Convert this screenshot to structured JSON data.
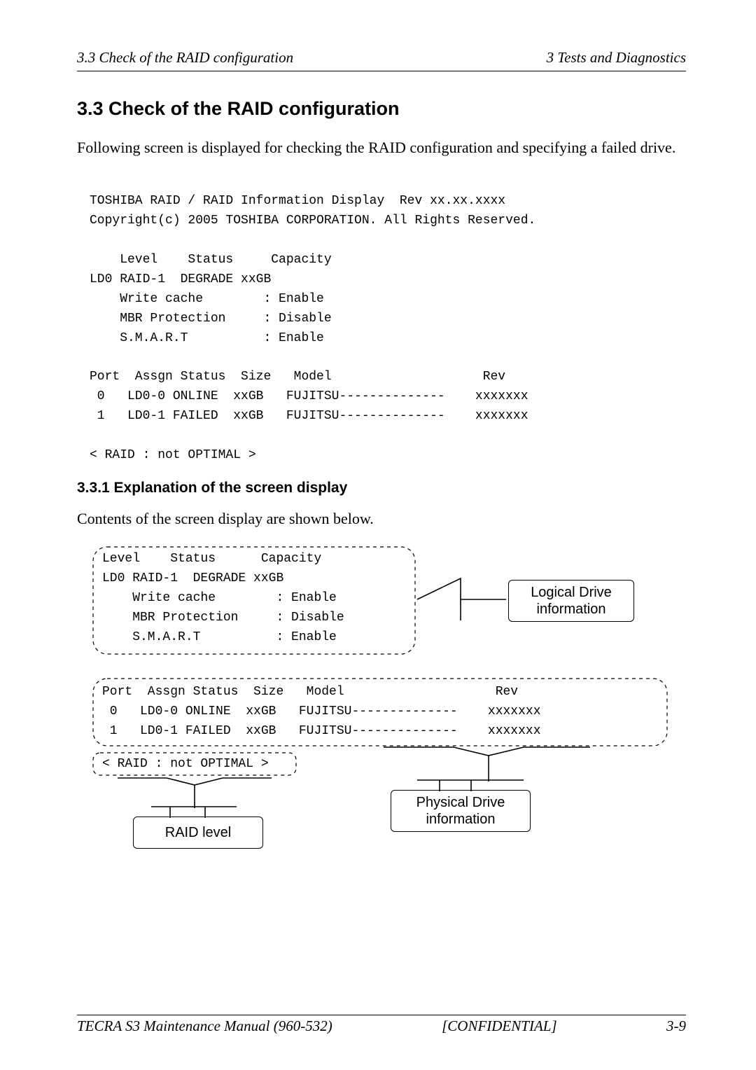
{
  "header": {
    "left": "3.3 Check of the RAID configuration",
    "right": "3  Tests and Diagnostics"
  },
  "section_title": "3.3    Check of the RAID configuration",
  "intro_para": "Following screen is displayed for checking the RAID configuration and specifying a failed drive.",
  "console": {
    "line1": "TOSHIBA RAID / RAID Information Display  Rev xx.xx.xxxx",
    "line2": "Copyright(c) 2005 TOSHIBA CORPORATION. All Rights Reserved.",
    "blank": "",
    "ld_header": "    Level    Status     Capacity",
    "ld0": "LD0 RAID-1  DEGRADE xxGB",
    "wc": "    Write cache        : Enable",
    "mbr": "    MBR Protection     : Disable",
    "smart": "    S.M.A.R.T          : Enable",
    "ph_header": "Port  Assgn Status  Size   Model                    Rev",
    "ph_row0": " 0   LD0-0 ONLINE  xxGB   FUJITSU--------------    xxxxxxx",
    "ph_row1": " 1   LD0-1 FAILED  xxGB   FUJITSU--------------    xxxxxxx",
    "last": "< RAID : not OPTIMAL >"
  },
  "subsection_title": "3.3.1  Explanation of the screen display",
  "subsection_para": "Contents of the screen display are shown below.",
  "diag": {
    "top_header": "Level    Status      Capacity",
    "top_ld0": "LD0 RAID-1  DEGRADE xxGB",
    "top_wc": "    Write cache        : Enable",
    "top_mbr": "    MBR Protection     : Disable",
    "top_smart": "    S.M.A.R.T          : Enable",
    "mid_header": "Port  Assgn Status  Size   Model                    Rev",
    "mid_row0": " 0   LD0-0 ONLINE  xxGB   FUJITSU--------------    xxxxxxx",
    "mid_row1": " 1   LD0-1 FAILED  xxGB   FUJITSU--------------    xxxxxxx",
    "raid_line": "< RAID : not OPTIMAL >",
    "logical_drive_label1": "Logical Drive",
    "logical_drive_label2": "information",
    "physical_drive_label1": "Physical Drive",
    "physical_drive_label2": "information",
    "raid_level_label": "RAID level"
  },
  "footer": {
    "left": "TECRA S3 Maintenance Manual (960-532)",
    "center": "[CONFIDENTIAL]",
    "right": "3-9"
  }
}
